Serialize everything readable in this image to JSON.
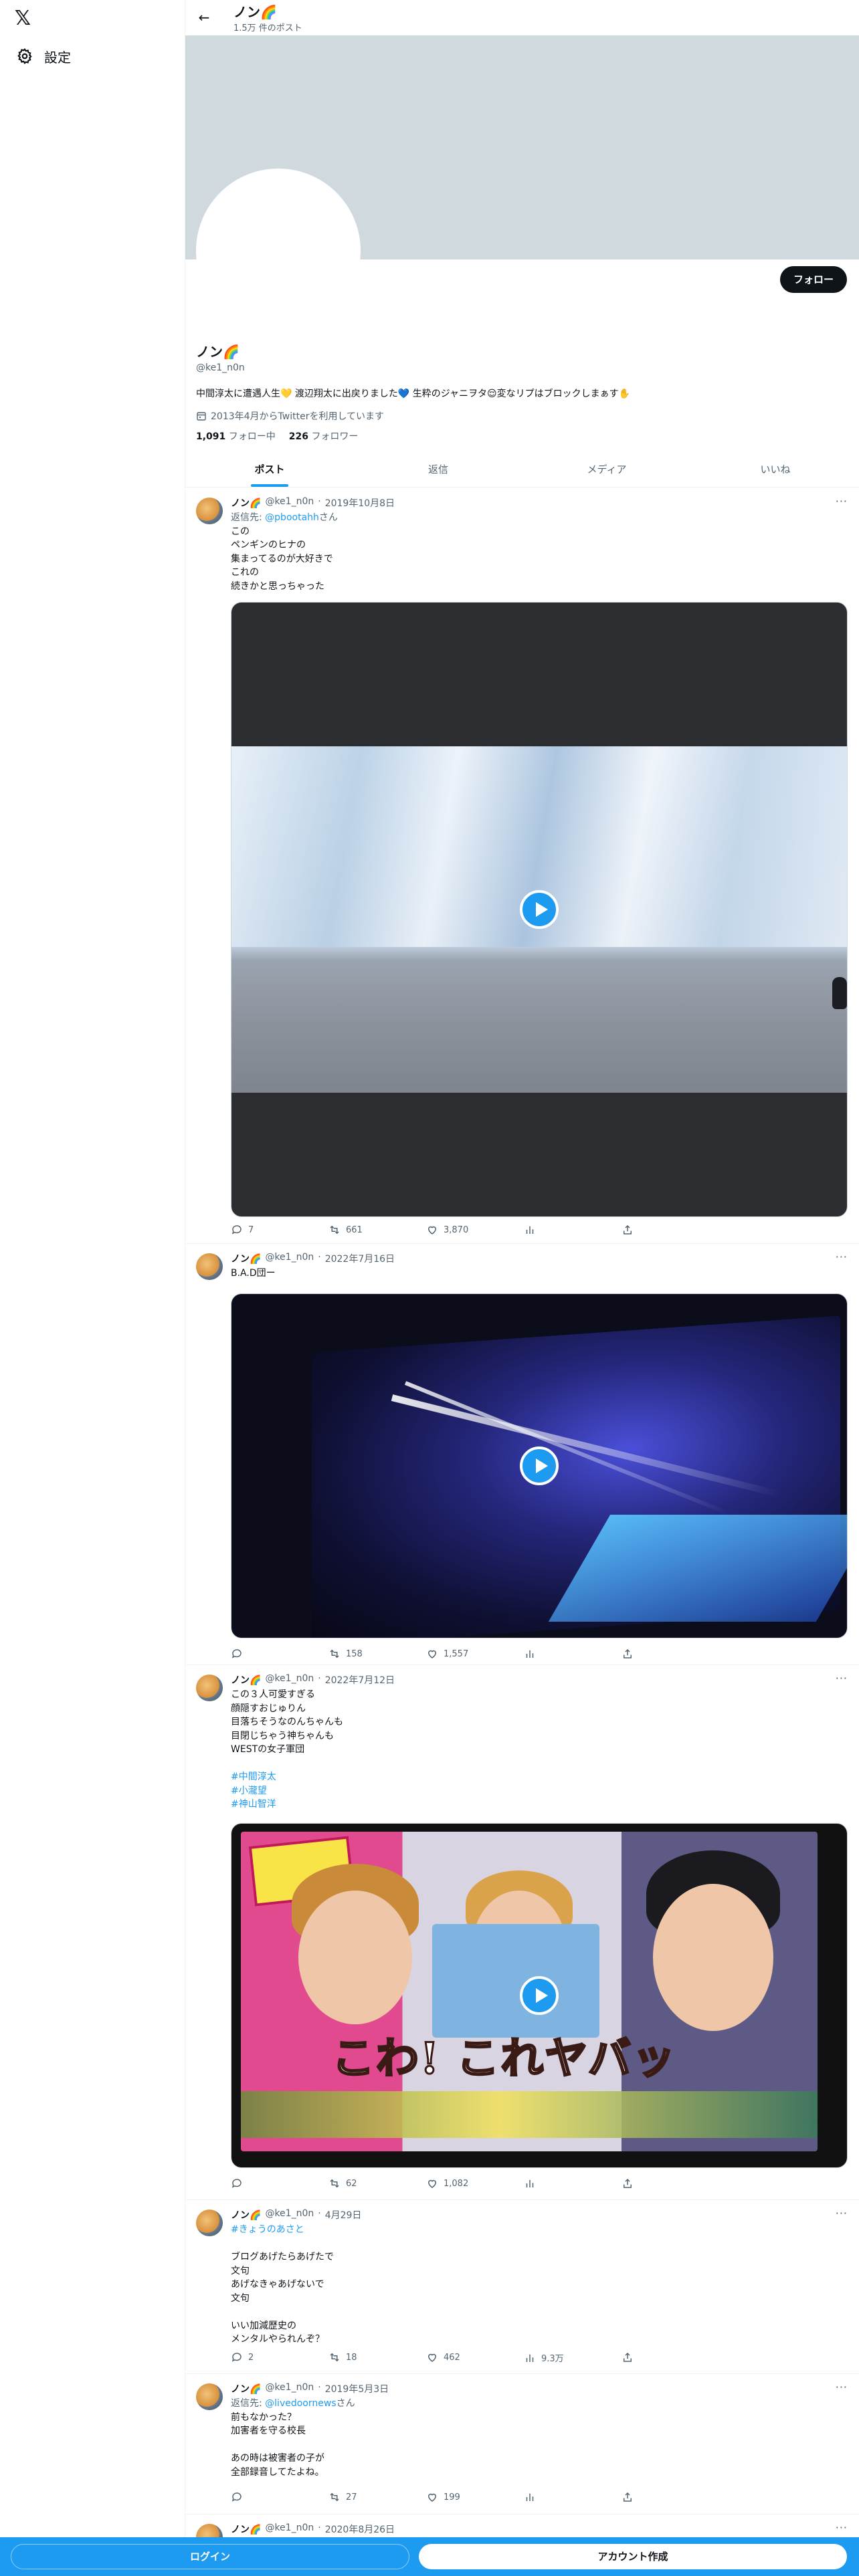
{
  "nav": {
    "logo": "𝕏",
    "settings_label": "設定"
  },
  "topbar": {
    "name": "ノン🌈",
    "post_count": "1.5万 件のポスト"
  },
  "profile": {
    "follow_label": "フォロー",
    "name": "ノン🌈",
    "handle": "@ke1_n0n",
    "bio": "中間淳太に遭遇人生💛 渡辺翔太に出戻りました💙 生粋のジャニヲタ😌変なリプはブロックしまぁす✋",
    "joined": "2013年4月からTwitterを利用しています",
    "following_count": "1,091",
    "following_label": "フォロー中",
    "followers_count": "226",
    "followers_label": "フォロワー"
  },
  "tabs": [
    {
      "label": "ポスト",
      "active": true
    },
    {
      "label": "返信",
      "active": false
    },
    {
      "label": "メディア",
      "active": false
    },
    {
      "label": "いいね",
      "active": false
    }
  ],
  "tweets": [
    {
      "name": "ノン🌈",
      "handle": "@ke1_n0n",
      "date": "2019年10月8日",
      "reply_prefix": "返信先: ",
      "reply_to": "@pbootahh",
      "reply_suffix": "さん",
      "lines": [
        "この",
        "ペンギンのヒナの",
        "集まってるのが大好きで",
        "これの",
        "続きかと思っちゃった"
      ],
      "replies": "7",
      "reposts": "661",
      "likes": "3,870",
      "views": ""
    },
    {
      "name": "ノン🌈",
      "handle": "@ke1_n0n",
      "date": "2022年7月16日",
      "lines": [
        "B.A.D団ー"
      ],
      "replies": "",
      "reposts": "158",
      "likes": "1,557",
      "views": ""
    },
    {
      "name": "ノン🌈",
      "handle": "@ke1_n0n",
      "date": "2022年7月12日",
      "lines": [
        "この３人可愛すぎる",
        "顔隠すおじゅりん",
        "目落ちそうなのんちゃんも",
        "目閉じちゃう神ちゃんも",
        "WESTの女子軍団",
        ""
      ],
      "hashtags": [
        "#中間淳太",
        "#小瀧望",
        "#神山智洋"
      ],
      "replies": "",
      "reposts": "62",
      "likes": "1,082",
      "views": ""
    },
    {
      "name": "ノン🌈",
      "handle": "@ke1_n0n",
      "date": "4月29日",
      "hashtag_line": "#きょうのあさと",
      "lines": [
        "",
        "ブログあげたらあげたで",
        "文句",
        "あげなきゃあげないで",
        "文句",
        "",
        "いい加減歴史の",
        "メンタルやられんぞ？"
      ],
      "replies": "2",
      "reposts": "18",
      "likes": "462",
      "views": "9.3万"
    },
    {
      "name": "ノン🌈",
      "handle": "@ke1_n0n",
      "date": "2019年5月3日",
      "reply_prefix": "返信先: ",
      "reply_to": "@livedoornews",
      "reply_suffix": "さん",
      "lines": [
        "前もなかった？",
        "加害者を守る校長",
        "",
        "あの時は被害者の子が",
        "全部録音してたよね。"
      ],
      "replies": "",
      "reposts": "27",
      "likes": "199",
      "views": ""
    },
    {
      "name": "ノン🌈",
      "handle": "@ke1_n0n",
      "date": "2020年8月26日",
      "lines": []
    }
  ],
  "bottom": {
    "login": "ログイン",
    "signup": "アカウント作成"
  },
  "colors": {
    "accent": "#1d9bf0",
    "banner": "#cfd9de",
    "text": "#0f1419",
    "muted": "#536471"
  }
}
